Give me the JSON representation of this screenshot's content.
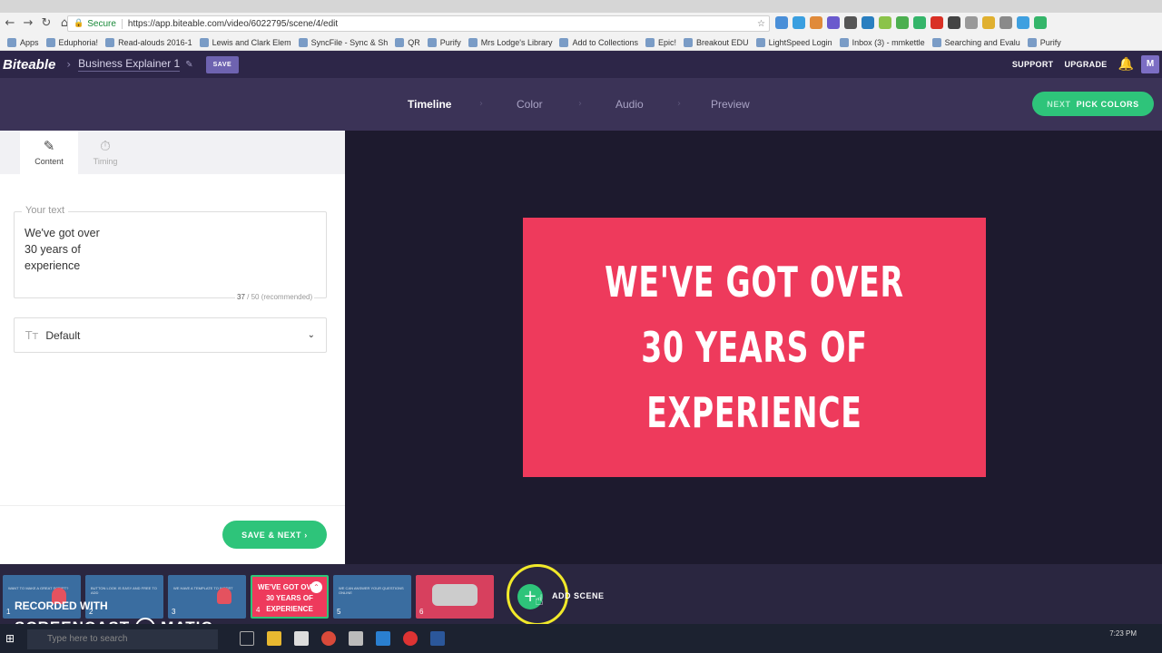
{
  "browser": {
    "secure_label": "Secure",
    "url": "https://app.biteable.com/video/6022795/scene/4/edit",
    "bookmarks": [
      "Apps",
      "Eduphoria!",
      "Read-alouds 2016-1",
      "Lewis and Clark Elem",
      "SyncFile - Sync & Sh",
      "QR",
      "Purify",
      "Mrs Lodge's Library",
      "Add to Collections",
      "Epic!",
      "Breakout EDU",
      "LightSpeed Login",
      "Inbox (3) - mmkettle",
      "Searching and Evalu",
      "Purify"
    ]
  },
  "header": {
    "logo": "Biteable",
    "project_name": "Business Explainer 1",
    "save_label": "SAVE",
    "support_label": "SUPPORT",
    "upgrade_label": "UPGRADE",
    "avatar_initial": "M"
  },
  "steps": {
    "items": [
      "Timeline",
      "Color",
      "Audio",
      "Preview"
    ],
    "active": "Timeline",
    "next_prefix": "NEXT",
    "next_label": "PICK COLORS"
  },
  "panel": {
    "tabs": [
      "Content",
      "Timing"
    ],
    "text_label": "Your text",
    "text_value": "We've got over\n30 years of\nexperience",
    "count": "37",
    "count_suffix": " / 50 (recommended)",
    "font_value": "Default",
    "save_next_label": "SAVE & NEXT ›"
  },
  "slide": {
    "text": "WE'VE GOT OVER\n30 YEARS OF\nEXPERIENCE",
    "background": "#ee3a5c"
  },
  "scenes": {
    "thumbs": [
      {
        "num": "1",
        "text": "WANT TO MAKE A GREAT SCRIPT?",
        "color": "#3a6da0"
      },
      {
        "num": "2",
        "text": "BUTTON LOOK IS EASY AND FREE TO ADD",
        "color": "#3a6da0"
      },
      {
        "num": "3",
        "text": "WE HAVE A TEMPLATE TO INSERT",
        "color": "#3a6da0"
      },
      {
        "num": "4",
        "text": "WE'VE GOT OVER\n30 YEARS OF\nEXPERIENCE",
        "color": "#ee3a5c"
      },
      {
        "num": "5",
        "text": "WE CAN ANSWER YOUR QUESTIONS ONLINE",
        "color": "#3a6da0"
      },
      {
        "num": "6",
        "text": "",
        "color": "#d7405e"
      }
    ],
    "add_label": "ADD SCENE"
  },
  "watermark": {
    "line1": "RECORDED WITH",
    "line2a": "SCREENCAST",
    "line2b": "MATIC"
  },
  "taskbar": {
    "search_placeholder": "Type here to search",
    "time": "7:23 PM"
  },
  "colors": {
    "accent_green": "#2ec47a",
    "header": "#2d2648",
    "steps_bar": "#3b3357",
    "canvas_bg": "#1d1a2e"
  }
}
